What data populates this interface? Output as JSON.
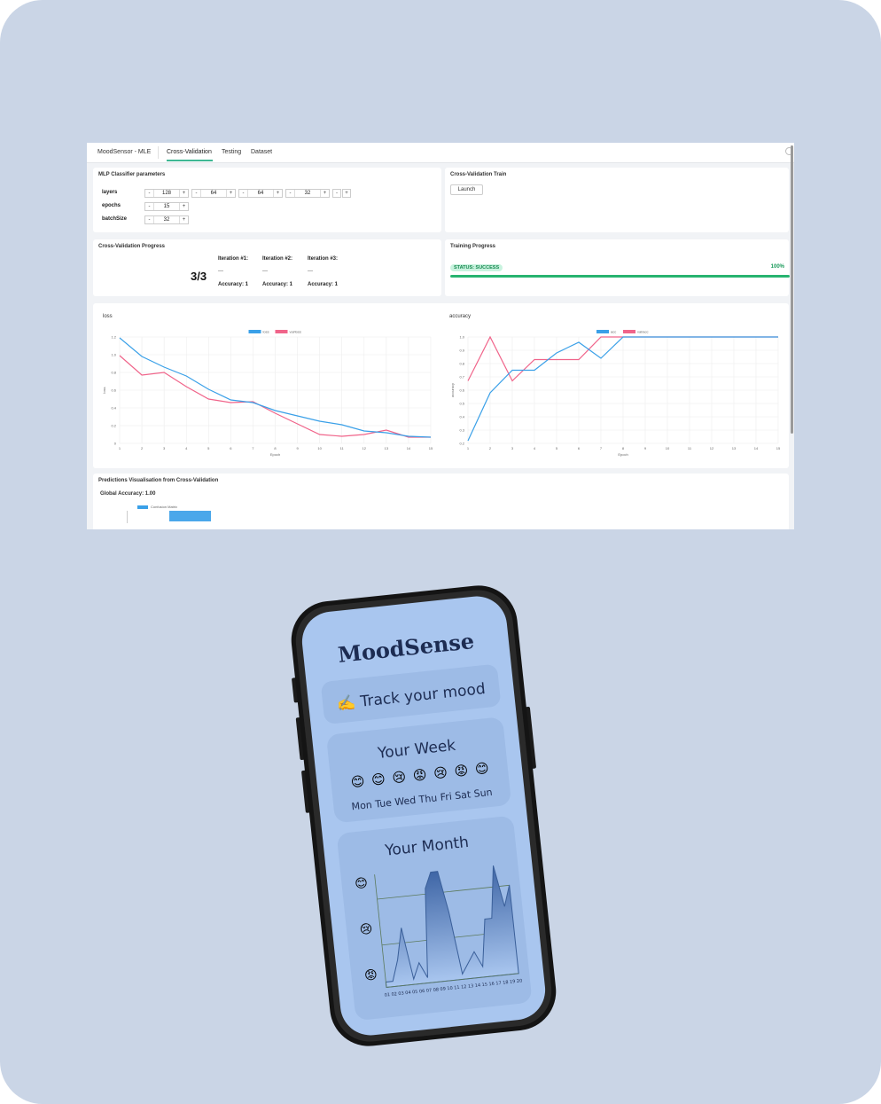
{
  "app": {
    "title": "MoodSensor - MLE",
    "tabs": [
      {
        "label": "Cross-Validation",
        "active": true
      },
      {
        "label": "Testing",
        "active": false
      },
      {
        "label": "Dataset",
        "active": false
      }
    ]
  },
  "mlp": {
    "title": "MLP Classifier parameters",
    "layers_label": "layers",
    "layers": [
      "128",
      "64",
      "64",
      "32"
    ],
    "epochs_label": "epochs",
    "epochs": "15",
    "batch_label": "batchSize",
    "batch": "32",
    "minus": "-",
    "plus": "+"
  },
  "cv_train": {
    "title": "Cross-Validation Train",
    "launch_label": "Launch"
  },
  "cv_progress": {
    "title": "Cross-Validation Progress",
    "count": "3/3",
    "iterations": [
      {
        "label": "Iteration #1:",
        "dash": "---",
        "acc": "Accuracy: 1"
      },
      {
        "label": "Iteration #2:",
        "dash": "---",
        "acc": "Accuracy: 1"
      },
      {
        "label": "Iteration #3:",
        "dash": "---",
        "acc": "Accuracy: 1"
      }
    ]
  },
  "training": {
    "title": "Training Progress",
    "status": "STATUS: SUCCESS",
    "percent_text": "100%",
    "progress": 1.0
  },
  "predictions": {
    "title": "Predictions Visualisation from Cross-Validation",
    "global_accuracy": "Global Accuracy: 1.00",
    "legend": "Confusion Matrix"
  },
  "chart_data": [
    {
      "type": "line",
      "title": "loss",
      "xlabel": "Epoch",
      "ylabel": "loss",
      "x": [
        1,
        2,
        3,
        4,
        5,
        6,
        7,
        8,
        9,
        10,
        11,
        12,
        13,
        14,
        15
      ],
      "yticks": [
        "0",
        "0.2",
        "0.4",
        "0.6",
        "0.8",
        "1.0",
        "1.2"
      ],
      "ylim": [
        0,
        1.2
      ],
      "legend_position": "top-center",
      "series": [
        {
          "name": "loss",
          "color": "#3aa0e8",
          "values": [
            1.19,
            0.98,
            0.86,
            0.76,
            0.61,
            0.49,
            0.46,
            0.37,
            0.31,
            0.25,
            0.21,
            0.14,
            0.12,
            0.08,
            0.07
          ]
        },
        {
          "name": "val/loss",
          "color": "#f0648a",
          "values": [
            0.99,
            0.77,
            0.8,
            0.64,
            0.5,
            0.46,
            0.47,
            0.34,
            0.22,
            0.1,
            0.08,
            0.1,
            0.15,
            0.07,
            0.07
          ]
        }
      ]
    },
    {
      "type": "line",
      "title": "accuracy",
      "xlabel": "Epoch",
      "ylabel": "accuracy",
      "x": [
        1,
        2,
        3,
        4,
        5,
        6,
        7,
        8,
        9,
        10,
        11,
        12,
        13,
        14,
        15
      ],
      "yticks": [
        "0.2",
        "0.3",
        "0.4",
        "0.5",
        "0.6",
        "0.7",
        "0.8",
        "0.9",
        "1.0"
      ],
      "ylim": [
        0.2,
        1.0
      ],
      "legend_position": "top-center",
      "series": [
        {
          "name": "acc",
          "color": "#3aa0e8",
          "values": [
            0.22,
            0.58,
            0.75,
            0.75,
            0.88,
            0.96,
            0.84,
            1.0,
            1.0,
            1.0,
            1.0,
            1.0,
            1.0,
            1.0,
            1.0
          ]
        },
        {
          "name": "val/acc",
          "color": "#f0648a",
          "values": [
            0.67,
            1.0,
            0.67,
            0.83,
            0.83,
            0.83,
            1.0,
            1.0,
            1.0,
            1.0,
            1.0,
            1.0,
            1.0,
            1.0,
            1.0
          ]
        }
      ]
    },
    {
      "type": "area",
      "title": "Your Month",
      "x": [
        "01",
        "02",
        "03",
        "04",
        "05",
        "06",
        "07",
        "08",
        "09",
        "10",
        "11",
        "12",
        "13",
        "14",
        "15",
        "16",
        "17",
        "18",
        "19",
        "20"
      ],
      "y_levels": [
        "😊",
        "😢",
        "😡"
      ],
      "values": [
        0,
        0,
        0.2,
        0.5,
        0,
        0.15,
        0,
        0.85,
        1.0,
        1.0,
        0.6,
        0,
        0.1,
        0.2,
        0.05,
        0.5,
        0.5,
        1.0,
        0.6,
        0.8
      ],
      "ylim": [
        0,
        1
      ]
    }
  ],
  "phone": {
    "brand": "MoodSense",
    "track_label": "✍️ Track your mood",
    "week_title": "Your Week",
    "week_emojis": [
      "😊",
      "😊",
      "😢",
      "😡",
      "😢",
      "😡",
      "😊"
    ],
    "week_days": "Mon Tue Wed Thu Fri Sat Sun",
    "month_title": "Your Month"
  },
  "colors": {
    "background": "#cad5e6",
    "accent_green": "#27b470",
    "series_blue": "#3aa0e8",
    "series_pink": "#f0648a",
    "phone_screen": "#a9c6ef",
    "brand_navy": "#1d2c52"
  }
}
